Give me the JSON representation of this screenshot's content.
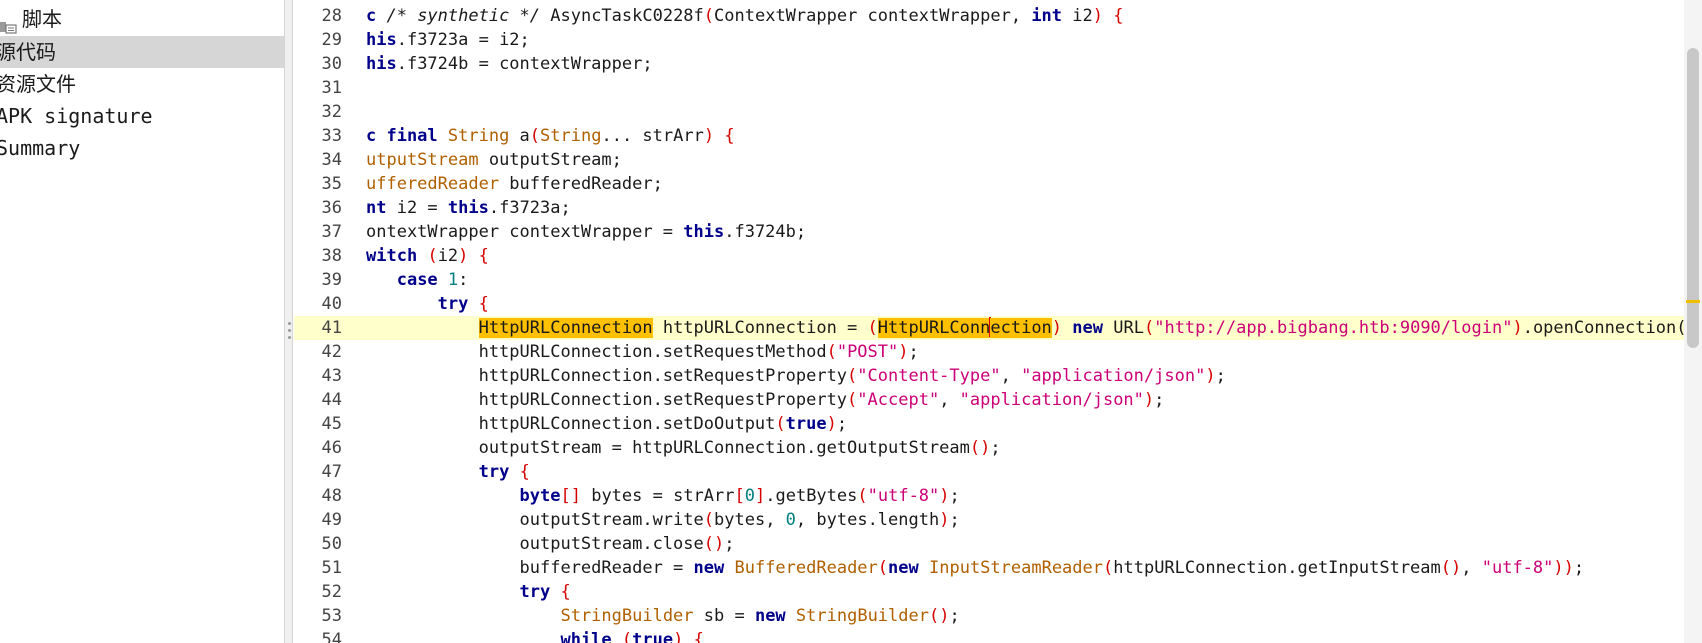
{
  "tree": {
    "top_partial": "",
    "items": [
      {
        "label": "脚本",
        "icon": "package-icon",
        "selected": false
      },
      {
        "label": "源代码",
        "selected": true
      },
      {
        "label": "资源文件",
        "selected": false
      },
      {
        "label": "APK signature",
        "selected": false
      },
      {
        "label": "Summary",
        "selected": false
      }
    ]
  },
  "editor": {
    "current_line": 41,
    "lines": [
      {
        "n": "28",
        "tokens": [
          [
            "kw",
            "c "
          ],
          [
            "cm",
            "/* synthetic */ "
          ],
          [
            "",
            "AsyncTaskC0228f"
          ],
          [
            "par",
            "("
          ],
          [
            "",
            "ContextWrapper contextWrapper, "
          ],
          [
            "kw",
            "int"
          ],
          [
            "",
            " i2"
          ],
          [
            "par",
            ")"
          ],
          [
            "",
            " "
          ],
          [
            "par",
            "{"
          ]
        ]
      },
      {
        "n": "29",
        "tokens": [
          [
            "kw",
            "his"
          ],
          [
            "",
            ".f3723a = i2;"
          ]
        ]
      },
      {
        "n": "30",
        "tokens": [
          [
            "kw",
            "his"
          ],
          [
            "",
            ".f3724b = contextWrapper;"
          ]
        ]
      },
      {
        "n": "31",
        "tokens": []
      },
      {
        "n": "32",
        "tokens": []
      },
      {
        "n": "33",
        "tokens": [
          [
            "kw",
            "c final "
          ],
          [
            "ty",
            "String"
          ],
          [
            "",
            " a"
          ],
          [
            "par",
            "("
          ],
          [
            "ty",
            "String"
          ],
          [
            "",
            "... strArr"
          ],
          [
            "par",
            ")"
          ],
          [
            "",
            " "
          ],
          [
            "par",
            "{"
          ]
        ]
      },
      {
        "n": "34",
        "tokens": [
          [
            "ty",
            "utputStream"
          ],
          [
            "",
            " outputStream;"
          ]
        ]
      },
      {
        "n": "35",
        "tokens": [
          [
            "ty",
            "ufferedReader"
          ],
          [
            "",
            " bufferedReader;"
          ]
        ]
      },
      {
        "n": "36",
        "tokens": [
          [
            "kw",
            "nt"
          ],
          [
            "",
            " i2 = "
          ],
          [
            "kw",
            "this"
          ],
          [
            "",
            ".f3723a;"
          ]
        ]
      },
      {
        "n": "37",
        "tokens": [
          [
            "",
            "ontextWrapper contextWrapper = "
          ],
          [
            "kw",
            "this"
          ],
          [
            "",
            ".f3724b;"
          ]
        ]
      },
      {
        "n": "38",
        "tokens": [
          [
            "kw",
            "witch"
          ],
          [
            "",
            " "
          ],
          [
            "par",
            "("
          ],
          [
            "",
            "i2"
          ],
          [
            "par",
            ")"
          ],
          [
            "",
            " "
          ],
          [
            "par",
            "{"
          ]
        ]
      },
      {
        "n": "39",
        "tokens": [
          [
            "",
            "   "
          ],
          [
            "kw",
            "case"
          ],
          [
            "",
            " "
          ],
          [
            "num",
            "1"
          ],
          [
            "",
            ":"
          ]
        ]
      },
      {
        "n": "40",
        "tokens": [
          [
            "",
            "       "
          ],
          [
            "kw",
            "try"
          ],
          [
            "",
            " "
          ],
          [
            "par",
            "{"
          ]
        ]
      },
      {
        "n": "41",
        "tokens": [
          [
            "",
            "           "
          ],
          [
            "hl",
            "HttpURLConnection"
          ],
          [
            "",
            " httpURLConnection = "
          ],
          [
            "par",
            "("
          ],
          [
            "hl",
            "HttpURLConn"
          ],
          [
            "caret",
            ""
          ],
          [
            "hl",
            "ection"
          ],
          [
            "par",
            ")"
          ],
          [
            "",
            " "
          ],
          [
            "kw",
            "new"
          ],
          [
            "",
            " URL"
          ],
          [
            "par",
            "("
          ],
          [
            "str",
            "\"http://app.bigbang.htb:9090/login\""
          ],
          [
            "par",
            ")"
          ],
          [
            "",
            ".openConnection();"
          ]
        ]
      },
      {
        "n": "42",
        "tokens": [
          [
            "",
            "           httpURLConnection.setRequestMethod"
          ],
          [
            "par",
            "("
          ],
          [
            "str",
            "\"POST\""
          ],
          [
            "par",
            ")"
          ],
          [
            "",
            ";"
          ]
        ]
      },
      {
        "n": "43",
        "tokens": [
          [
            "",
            "           httpURLConnection.setRequestProperty"
          ],
          [
            "par",
            "("
          ],
          [
            "str",
            "\"Content-Type\""
          ],
          [
            "",
            ", "
          ],
          [
            "str",
            "\"application/json\""
          ],
          [
            "par",
            ")"
          ],
          [
            "",
            ";"
          ]
        ]
      },
      {
        "n": "44",
        "tokens": [
          [
            "",
            "           httpURLConnection.setRequestProperty"
          ],
          [
            "par",
            "("
          ],
          [
            "str",
            "\"Accept\""
          ],
          [
            "",
            ", "
          ],
          [
            "str",
            "\"application/json\""
          ],
          [
            "par",
            ")"
          ],
          [
            "",
            ";"
          ]
        ]
      },
      {
        "n": "45",
        "tokens": [
          [
            "",
            "           httpURLConnection.setDoOutput"
          ],
          [
            "par",
            "("
          ],
          [
            "kw",
            "true"
          ],
          [
            "par",
            ")"
          ],
          [
            "",
            ";"
          ]
        ]
      },
      {
        "n": "46",
        "tokens": [
          [
            "",
            "           outputStream = httpURLConnection.getOutputStream"
          ],
          [
            "par",
            "()"
          ],
          [
            "",
            ";"
          ]
        ]
      },
      {
        "n": "47",
        "tokens": [
          [
            "",
            "           "
          ],
          [
            "kw",
            "try"
          ],
          [
            "",
            " "
          ],
          [
            "par",
            "{"
          ]
        ]
      },
      {
        "n": "48",
        "tokens": [
          [
            "",
            "               "
          ],
          [
            "kw",
            "byte"
          ],
          [
            "par",
            "[]"
          ],
          [
            "",
            " bytes = strArr"
          ],
          [
            "par",
            "["
          ],
          [
            "num",
            "0"
          ],
          [
            "par",
            "]"
          ],
          [
            "",
            ".getBytes"
          ],
          [
            "par",
            "("
          ],
          [
            "str",
            "\"utf-8\""
          ],
          [
            "par",
            ")"
          ],
          [
            "",
            ";"
          ]
        ]
      },
      {
        "n": "49",
        "tokens": [
          [
            "",
            "               outputStream.write"
          ],
          [
            "par",
            "("
          ],
          [
            "",
            "bytes, "
          ],
          [
            "num",
            "0"
          ],
          [
            "",
            ", bytes.length"
          ],
          [
            "par",
            ")"
          ],
          [
            "",
            ";"
          ]
        ]
      },
      {
        "n": "50",
        "tokens": [
          [
            "",
            "               outputStream.close"
          ],
          [
            "par",
            "()"
          ],
          [
            "",
            ";"
          ]
        ]
      },
      {
        "n": "51",
        "tokens": [
          [
            "",
            "               bufferedReader = "
          ],
          [
            "kw",
            "new"
          ],
          [
            "",
            " "
          ],
          [
            "ty",
            "BufferedReader"
          ],
          [
            "par",
            "("
          ],
          [
            "kw",
            "new"
          ],
          [
            "",
            " "
          ],
          [
            "ty",
            "InputStreamReader"
          ],
          [
            "par",
            "("
          ],
          [
            "",
            "httpURLConnection.getInputStream"
          ],
          [
            "par",
            "()"
          ],
          [
            "",
            ", "
          ],
          [
            "str",
            "\"utf-8\""
          ],
          [
            "par",
            "))"
          ],
          [
            "",
            ";"
          ]
        ]
      },
      {
        "n": "52",
        "tokens": [
          [
            "",
            "               "
          ],
          [
            "kw",
            "try"
          ],
          [
            "",
            " "
          ],
          [
            "par",
            "{"
          ]
        ]
      },
      {
        "n": "53",
        "tokens": [
          [
            "",
            "                   "
          ],
          [
            "ty",
            "StringBuilder"
          ],
          [
            "",
            " sb = "
          ],
          [
            "kw",
            "new"
          ],
          [
            "",
            " "
          ],
          [
            "ty",
            "StringBuilder"
          ],
          [
            "par",
            "()"
          ],
          [
            "",
            ";"
          ]
        ]
      },
      {
        "n": "54",
        "tokens": [
          [
            "",
            "                   "
          ],
          [
            "kw",
            "while"
          ],
          [
            "",
            " "
          ],
          [
            "par",
            "("
          ],
          [
            "kw",
            "true"
          ],
          [
            "par",
            ")"
          ],
          [
            "",
            " "
          ],
          [
            "par",
            "{"
          ]
        ]
      }
    ]
  },
  "colors": {
    "keyword": "#00008b",
    "type": "#b06000",
    "string": "#cc0077",
    "paren": "#d60000",
    "highlight": "#ffc000",
    "current_line": "#ffffcc",
    "selected_tree": "#d6d6d6"
  }
}
